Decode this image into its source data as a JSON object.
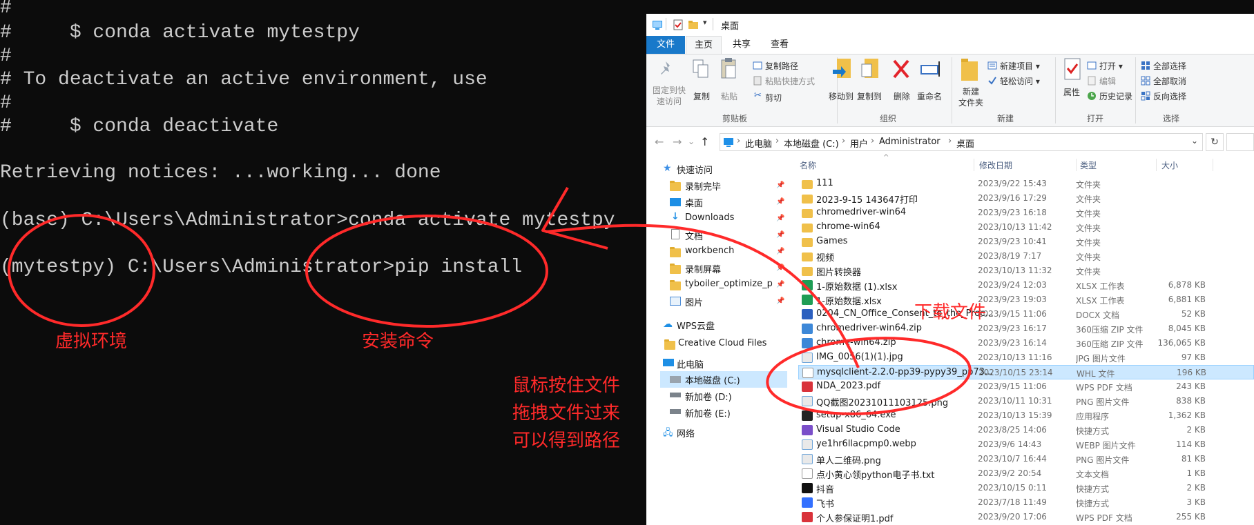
{
  "terminal": {
    "lines": [
      "#",
      "#     $ conda activate mytestpy",
      "#",
      "# To deactivate an active environment, use",
      "#",
      "#     $ conda deactivate",
      "Retrieving notices: ...working... done",
      "(base) C:\\Users\\Administrator>conda activate mytestpy",
      "(mytestpy) C:\\Users\\Administrator>pip install"
    ]
  },
  "explorer": {
    "title": "桌面",
    "tabs": [
      "文件",
      "主页",
      "共享",
      "查看"
    ],
    "ribbon": {
      "pin_quick": "固定到快\n速访问",
      "copy": "复制",
      "paste": "粘贴",
      "copy_path": "复制路径",
      "paste_shortcut": "粘贴快捷方式",
      "cut": "剪切",
      "clipboard": "剪贴板",
      "move_to": "移动到",
      "copy_to": "复制到",
      "delete": "删除",
      "rename": "重命名",
      "organize": "组织",
      "new_folder": "新建\n文件夹",
      "new_item": "新建项目 ▾",
      "easy_access": "轻松访问 ▾",
      "new": "新建",
      "properties": "属性",
      "open": "打开 ▾",
      "edit": "编辑",
      "history": "历史记录",
      "open_group": "打开",
      "select_all": "全部选择",
      "select_none": "全部取消",
      "invert": "反向选择",
      "select_group": "选择"
    },
    "breadcrumb": [
      "此电脑",
      "本地磁盘 (C:)",
      "用户",
      "Administrator",
      "桌面"
    ],
    "nav": {
      "quick_access": "快速访问",
      "items": [
        "录制完毕",
        "桌面",
        "Downloads",
        "文档",
        "workbench",
        "录制屏幕",
        "tyboiler_optimize_platfo",
        "图片"
      ],
      "wps": "WPS云盘",
      "creative": "Creative Cloud Files",
      "this_pc": "此电脑",
      "drives": [
        "本地磁盘 (C:)",
        "新加卷 (D:)",
        "新加卷 (E:)"
      ],
      "network": "网络"
    },
    "columns": [
      "名称",
      "修改日期",
      "类型",
      "大小"
    ],
    "files": [
      {
        "name": "111",
        "date": "2023/9/22 15:43",
        "type": "文件夹",
        "size": "",
        "icon": "folder"
      },
      {
        "name": "2023-9-15 143647打印",
        "date": "2023/9/16 17:29",
        "type": "文件夹",
        "size": "",
        "icon": "folder"
      },
      {
        "name": "chromedriver-win64",
        "date": "2023/9/23 16:18",
        "type": "文件夹",
        "size": "",
        "icon": "folder"
      },
      {
        "name": "chrome-win64",
        "date": "2023/10/13 11:42",
        "type": "文件夹",
        "size": "",
        "icon": "folder"
      },
      {
        "name": "Games",
        "date": "2023/9/23 10:41",
        "type": "文件夹",
        "size": "",
        "icon": "folder"
      },
      {
        "name": "视频",
        "date": "2023/8/19 7:17",
        "type": "文件夹",
        "size": "",
        "icon": "folder"
      },
      {
        "name": "图片转换器",
        "date": "2023/10/13 11:32",
        "type": "文件夹",
        "size": "",
        "icon": "folder"
      },
      {
        "name": "1-原始数据 (1).xlsx",
        "date": "2023/9/24 12:03",
        "type": "XLSX 工作表",
        "size": "6,878 KB",
        "icon": "xlsx"
      },
      {
        "name": "1-原始数据.xlsx",
        "date": "2023/9/23 19:03",
        "type": "XLSX 工作表",
        "size": "6,881 KB",
        "icon": "xlsx"
      },
      {
        "name": "0204_CN_Office_Consent_to_the_Proc...",
        "date": "2023/9/15 11:06",
        "type": "DOCX 文档",
        "size": "52 KB",
        "icon": "docx"
      },
      {
        "name": "chromedriver-win64.zip",
        "date": "2023/9/23 16:17",
        "type": "360压缩 ZIP 文件",
        "size": "8,045 KB",
        "icon": "zip"
      },
      {
        "name": "chrome-win64.zip",
        "date": "2023/9/23 16:14",
        "type": "360压缩 ZIP 文件",
        "size": "136,065 KB",
        "icon": "zip"
      },
      {
        "name": "IMG_0056(1)(1).jpg",
        "date": "2023/10/13 11:16",
        "type": "JPG 图片文件",
        "size": "97 KB",
        "icon": "jpg"
      },
      {
        "name": "mysqlclient-2.2.0-pp39-pypy39_pp73...",
        "date": "2023/10/15 23:14",
        "type": "WHL 文件",
        "size": "196 KB",
        "icon": "whl",
        "selected": true
      },
      {
        "name": "NDA_2023.pdf",
        "date": "2023/9/15 11:06",
        "type": "WPS PDF 文档",
        "size": "243 KB",
        "icon": "pdf"
      },
      {
        "name": "QQ截图20231011103125.png",
        "date": "2023/10/11 10:31",
        "type": "PNG 图片文件",
        "size": "838 KB",
        "icon": "png"
      },
      {
        "name": "setup-x86_64.exe",
        "date": "2023/10/13 15:39",
        "type": "应用程序",
        "size": "1,362 KB",
        "icon": "exe"
      },
      {
        "name": "Visual Studio Code",
        "date": "2023/8/25 14:06",
        "type": "快捷方式",
        "size": "2 KB",
        "icon": "vs"
      },
      {
        "name": "ye1hr6llacpmp0.webp",
        "date": "2023/9/6 14:43",
        "type": "WEBP 图片文件",
        "size": "114 KB",
        "icon": "webp"
      },
      {
        "name": "单人二维码.png",
        "date": "2023/10/7 16:44",
        "type": "PNG 图片文件",
        "size": "81 KB",
        "icon": "png"
      },
      {
        "name": "点小黄心领python电子书.txt",
        "date": "2023/9/2 20:54",
        "type": "文本文档",
        "size": "1 KB",
        "icon": "txt"
      },
      {
        "name": "抖音",
        "date": "2023/10/15 0:11",
        "type": "快捷方式",
        "size": "2 KB",
        "icon": "douyin"
      },
      {
        "name": "飞书",
        "date": "2023/7/18 11:49",
        "type": "快捷方式",
        "size": "3 KB",
        "icon": "feishu"
      },
      {
        "name": "个人参保证明1.pdf",
        "date": "2023/9/20 17:06",
        "type": "WPS PDF 文档",
        "size": "255 KB",
        "icon": "pdf"
      }
    ]
  },
  "annotations": {
    "virtual_env": "虚拟环境",
    "install_cmd": "安装命令",
    "download_file": "下载文件",
    "drag_hint": [
      "鼠标按住文件",
      "拖拽文件过来",
      "可以得到路径"
    ]
  },
  "colors": {
    "annotation_red": "#ff2a2a",
    "terminal_bg": "#0c0c0c",
    "terminal_text": "#cccccc",
    "ribbon_file_tab": "#1979ca",
    "selection": "#cce8ff"
  }
}
